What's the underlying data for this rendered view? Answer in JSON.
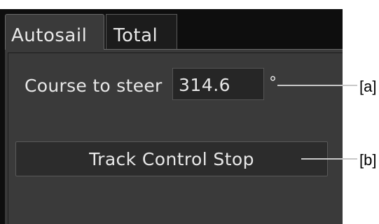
{
  "tabs": [
    {
      "label": "Autosail",
      "active": true
    },
    {
      "label": "Total",
      "active": false
    }
  ],
  "course_to_steer": {
    "label": "Course to steer",
    "value": "314.6",
    "unit": "°"
  },
  "track_control_button": {
    "label": "Track Control Stop"
  },
  "callouts": {
    "a": "[a]",
    "b": "[b]"
  },
  "colors": {
    "panel_background": "#3a3a3a",
    "frame_background": "#0e0e0e",
    "text": "#e8e8e8",
    "leader_line": "#c8c8c8"
  }
}
